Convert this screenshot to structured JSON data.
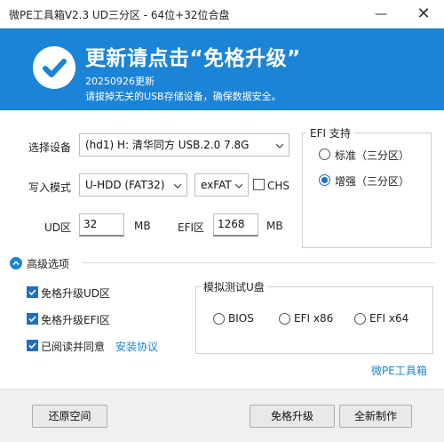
{
  "window": {
    "title": "微PE工具箱V2.3 UD三分区 - 64位+32位合盘",
    "minimize_glyph": "—",
    "close_glyph": "✕"
  },
  "banner": {
    "headline": "更新请点击“免格升级”",
    "date": "20250926更新",
    "hint": "请拔掉无关的USB存储设备，确保数据安全。",
    "icon": "checkmark-icon",
    "color": "#1b84d6"
  },
  "form": {
    "device_label": "选择设备",
    "device_value": "(hd1) H: 清华同方 USB.2.0 7.8G",
    "write_mode_label": "写入模式",
    "write_mode_value": "U-HDD (FAT32)",
    "fs_value": "exFAT",
    "chs_label": "CHS",
    "chs_checked": false,
    "ud_label": "UD区",
    "ud_value": "32",
    "ud_unit": "MB",
    "efi_label": "EFI区",
    "efi_value": "1268",
    "efi_unit": "MB"
  },
  "efi_support": {
    "title": "EFI 支持",
    "options": [
      {
        "label": "标准（三分区）",
        "selected": false
      },
      {
        "label": "增强（三分区）",
        "selected": true
      }
    ]
  },
  "advanced": {
    "title": "高级选项",
    "options": [
      {
        "label": "免格升级UD区",
        "checked": true
      },
      {
        "label": "免格升级EFI区",
        "checked": true
      },
      {
        "label": "已阅读并同意",
        "checked": true
      }
    ],
    "agreement_link": "安装协议"
  },
  "emulate": {
    "title": "模拟测试U盘",
    "options": [
      {
        "label": "BIOS",
        "selected": false
      },
      {
        "label": "EFI x86",
        "selected": false
      },
      {
        "label": "EFI x64",
        "selected": false
      }
    ]
  },
  "brand_link": "微PE工具箱",
  "buttons": {
    "restore": "还原空间",
    "upgrade": "免格升级",
    "new_install": "全新制作"
  },
  "colors": {
    "accent": "#1b84d6",
    "check": "#1f6fc2"
  }
}
